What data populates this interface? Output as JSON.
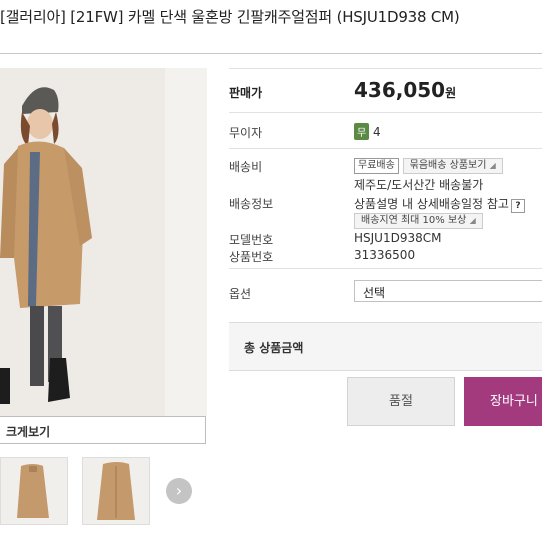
{
  "product": {
    "title": "[갤러리아] [21FW] 카멜 단색 울혼방 긴팔캐주얼점퍼 (HSJU1D938 CM)",
    "zoom_label": "크게보기"
  },
  "info": {
    "price_label": "판매가",
    "price": "436,050",
    "price_unit": "원",
    "interest_label": "무이자",
    "interest_badge": "무",
    "interest_months": "4",
    "shipping_fee_label": "배송비",
    "free_shipping_tag": "무료배송",
    "bundle_shipping_btn": "묶음배송 상품보기",
    "island_notice": "제주도/도서산간 배송불가",
    "shipping_info_label": "배송정보",
    "shipping_info_text": "상품설명 내 상세배송일정 참고",
    "help_icon": "?",
    "delay_comp_tag": "배송지연 최대 10% 보상",
    "model_label": "모델번호",
    "model_value": "HSJU1D938CM",
    "product_no_label": "상품번호",
    "product_no_value": "31336500",
    "option_label": "옵션",
    "option_selected": "선택",
    "total_label": "총 상품금액",
    "soldout_btn": "품절",
    "cart_btn": "장바구니"
  }
}
